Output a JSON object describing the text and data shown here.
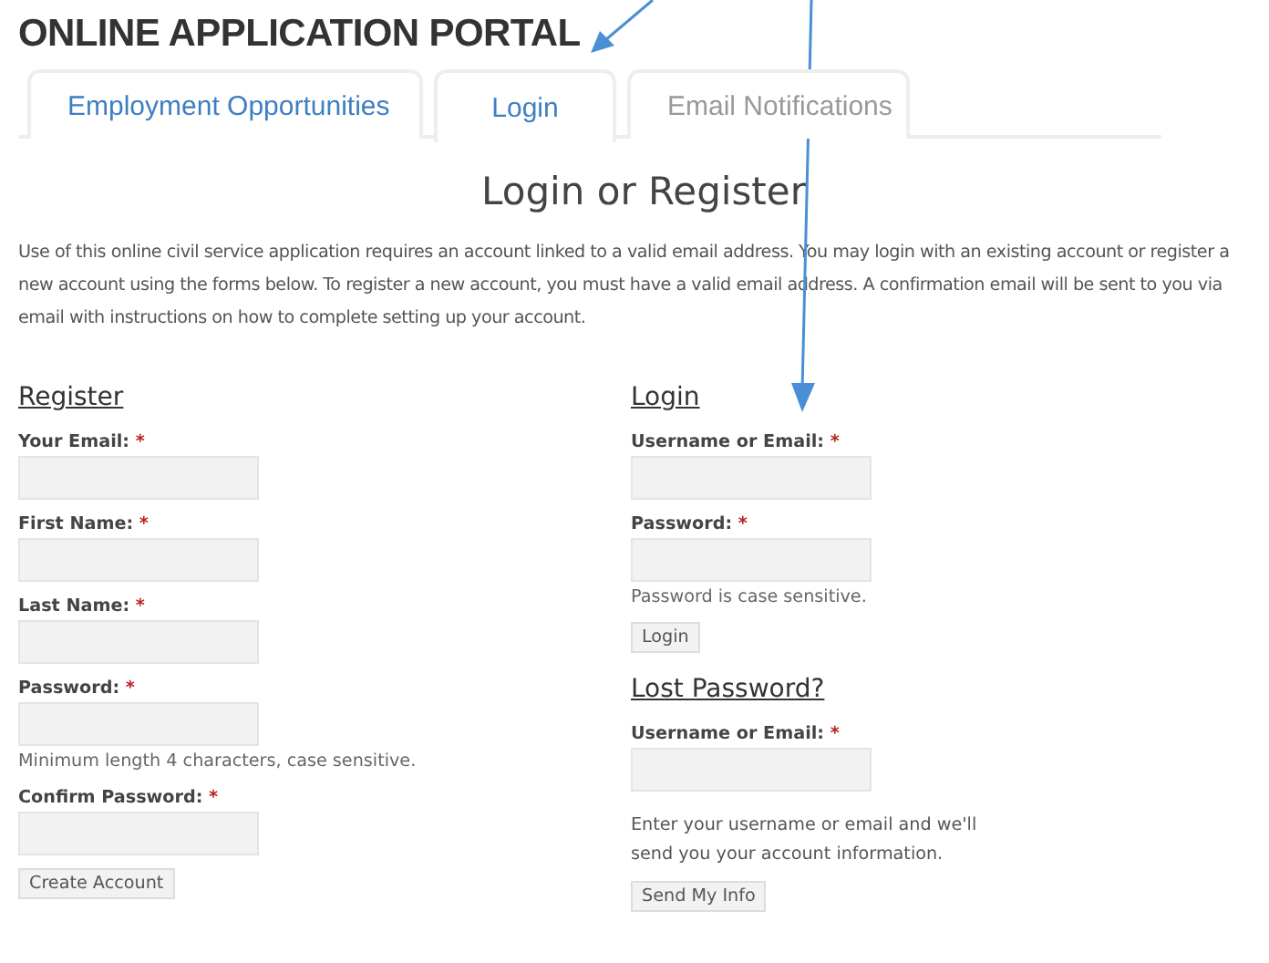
{
  "portal": {
    "title": "ONLINE APPLICATION PORTAL"
  },
  "tabs": [
    {
      "label": "Employment Opportunities",
      "selected": false,
      "disabled": false
    },
    {
      "label": "Login",
      "selected": true,
      "disabled": false
    },
    {
      "label": "Email Notifications",
      "selected": false,
      "disabled": true
    }
  ],
  "page": {
    "heading": "Login or Register",
    "intro": "Use of this online civil service application requires an account linked to a valid email address. You may login with an existing account or register a new account using the forms below. To register a new account, you must have a valid email address. A confirmation email will be sent to you via email with instructions on how to complete setting up your account."
  },
  "register": {
    "heading": "Register",
    "fields": [
      {
        "label": "Your Email:",
        "marker": "*"
      },
      {
        "label": "First Name:",
        "marker": "*"
      },
      {
        "label": "Last Name:",
        "marker": "*"
      },
      {
        "label": "Password:",
        "marker": "*",
        "hint": "Minimum length 4 characters, case sensitive."
      },
      {
        "label": "Confirm Password:",
        "marker": "*"
      }
    ],
    "button": "Create Account"
  },
  "login": {
    "heading": "Login",
    "fields": [
      {
        "label": "Username or Email:",
        "marker": "*"
      },
      {
        "label": "Password:",
        "marker": "*",
        "hint": "Password is case sensitive."
      }
    ],
    "button": "Login"
  },
  "lost_password": {
    "heading": "Lost Password?",
    "fields": [
      {
        "label": "Username or Email:",
        "marker": "*"
      }
    ],
    "note": "Enter your username or email and we'll send you your account information.",
    "button": "Send My Info"
  }
}
